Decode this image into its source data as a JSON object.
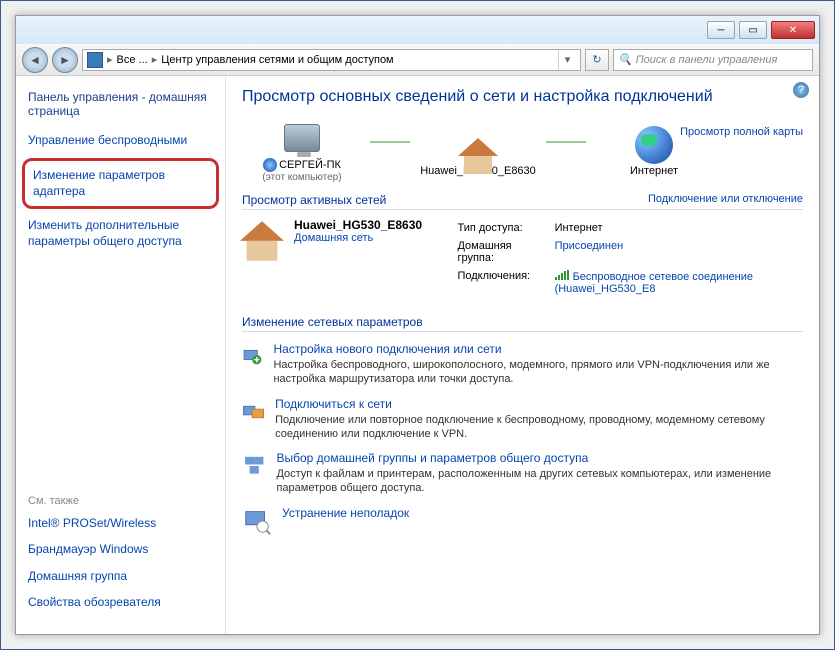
{
  "breadcrumb": {
    "seg1": "Все ...",
    "seg2": "Центр управления сетями и общим доступом"
  },
  "search": {
    "placeholder": "Поиск в панели управления"
  },
  "sidebar": {
    "home": "Панель управления - домашняя страница",
    "items": [
      "Управление беспроводными",
      "Изменение параметров адаптера",
      "Изменить дополнительные параметры общего доступа"
    ],
    "see_also_label": "См. также",
    "see_also": [
      "Intel® PROSet/Wireless",
      "Брандмауэр Windows",
      "Домашняя группа",
      "Свойства обозревателя"
    ]
  },
  "main": {
    "title": "Просмотр основных сведений о сети и настройка подключений",
    "full_map": "Просмотр полной карты",
    "map": {
      "pc": "СЕРГЕЙ-ПК",
      "pc_sub": "(этот компьютер)",
      "router": "Huawei_HG530_E8630",
      "internet": "Интернет"
    },
    "active_header": "Просмотр активных сетей",
    "active_link": "Подключение или отключение",
    "network": {
      "name": "Huawei_HG530_E8630",
      "type": "Домашняя сеть",
      "access_label": "Тип доступа:",
      "access_value": "Интернет",
      "homegroup_label": "Домашняя группа:",
      "homegroup_value": "Присоединен",
      "conn_label": "Подключения:",
      "conn_value": "Беспроводное сетевое соединение (Huawei_HG530_E8"
    },
    "settings_header": "Изменение сетевых параметров",
    "tasks": [
      {
        "title": "Настройка нового подключения или сети",
        "desc": "Настройка беспроводного, широкополосного, модемного, прямого или VPN-подключения или же настройка маршрутизатора или точки доступа."
      },
      {
        "title": "Подключиться к сети",
        "desc": "Подключение или повторное подключение к беспроводному, проводному, модемному сетевому соединению или подключение к VPN."
      },
      {
        "title": "Выбор домашней группы и параметров общего доступа",
        "desc": "Доступ к файлам и принтерам, расположенным на других сетевых компьютерах, или изменение параметров общего доступа."
      },
      {
        "title": "Устранение неполадок",
        "desc": ""
      }
    ]
  }
}
